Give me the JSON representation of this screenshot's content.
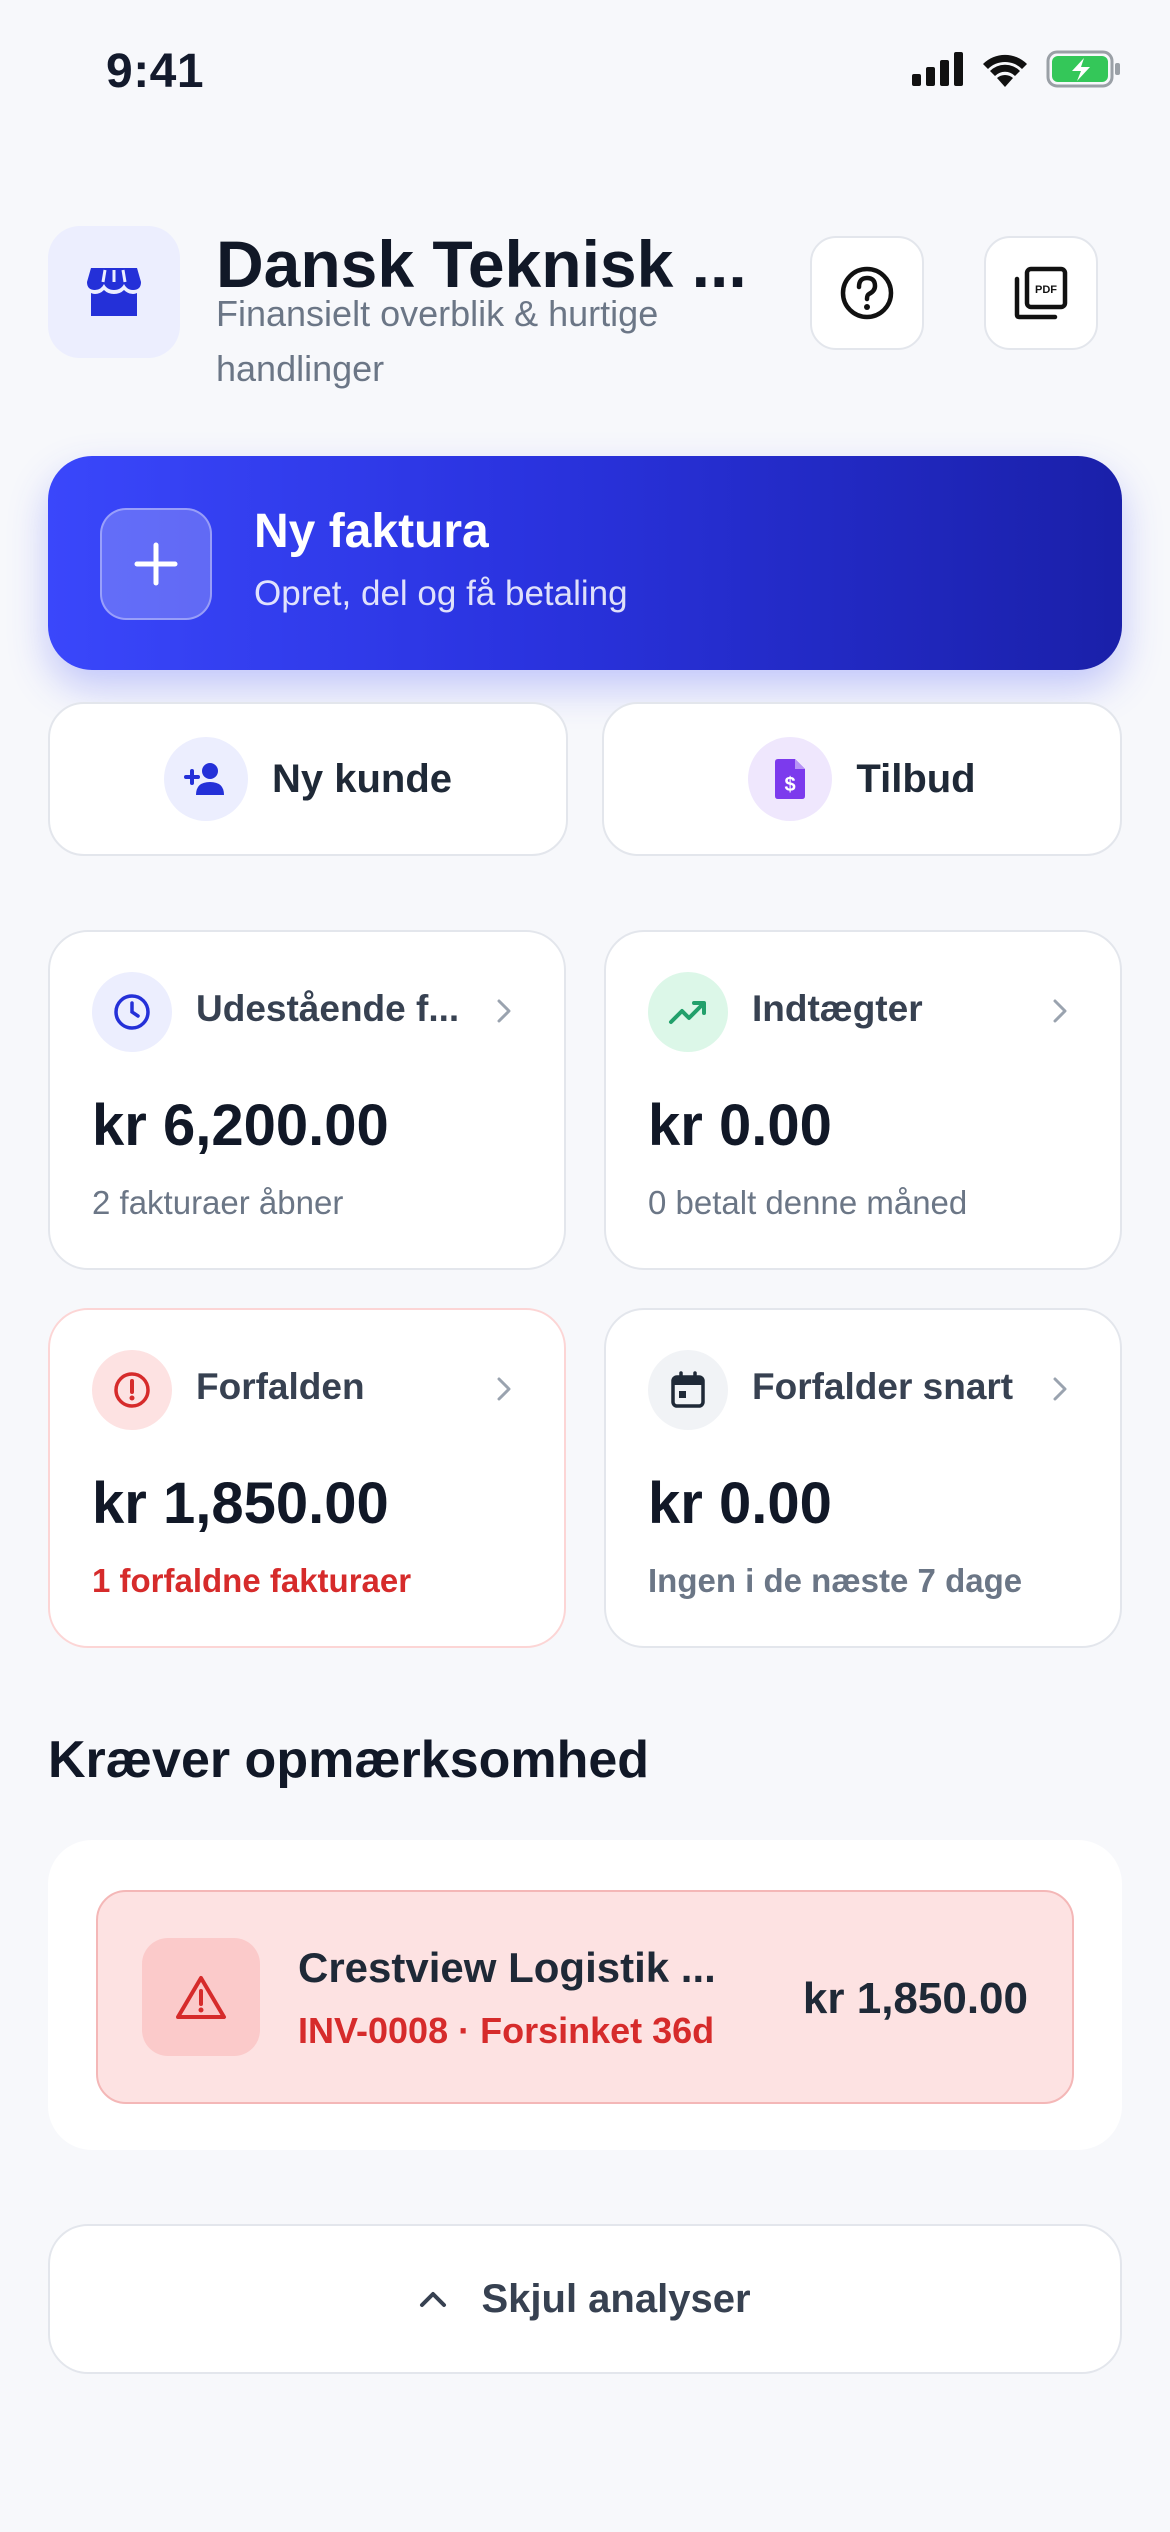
{
  "status_bar": {
    "time": "9:41",
    "icons": [
      "signal-icon",
      "wifi-icon",
      "battery-charging-icon"
    ]
  },
  "header": {
    "title": "Dansk Teknisk ...",
    "subtitle": "Finansielt overblik & hurtige handlinger",
    "pdf_label": "PDF",
    "icons": [
      "store-icon",
      "help-icon",
      "pdf-icon"
    ]
  },
  "primary_action": {
    "title": "Ny faktura",
    "subtitle": "Opret, del og få betaling",
    "icon": "plus-icon"
  },
  "quick_actions": [
    {
      "label": "Ny kunde",
      "icon": "add-user-icon"
    },
    {
      "label": "Tilbud",
      "icon": "quote-document-icon"
    }
  ],
  "stats": [
    {
      "label": "Udestående f...",
      "value": "kr 6,200.00",
      "note": "2 fakturaer åbner",
      "icon": "clock-icon"
    },
    {
      "label": "Indtægter",
      "value": "kr 0.00",
      "note": "0 betalt denne måned",
      "icon": "trending-up-icon"
    },
    {
      "label": "Forfalden",
      "value": "kr 1,850.00",
      "note": "1 forfaldne fakturaer",
      "icon": "alert-circle-icon"
    },
    {
      "label": "Forfalder snart",
      "value": "kr 0.00",
      "note": "Ingen i de næste 7 dage",
      "icon": "calendar-icon"
    }
  ],
  "attention": {
    "title": "Kræver opmærksomhed",
    "items": [
      {
        "name": "Crestview Logistik ...",
        "meta": "INV-0008 · Forsinket 36d",
        "amount": "kr 1,850.00",
        "icon": "warning-triangle-icon"
      }
    ]
  },
  "toggle_analytics": {
    "label": "Skjul analyser",
    "icon": "chevron-up-icon"
  },
  "colors": {
    "primary": "#3a47fb",
    "primary_dark": "#1a20a9",
    "danger": "#d62b2b",
    "success": "#22a06b",
    "purple": "#7c3aed",
    "background": "#f7f8fb"
  }
}
